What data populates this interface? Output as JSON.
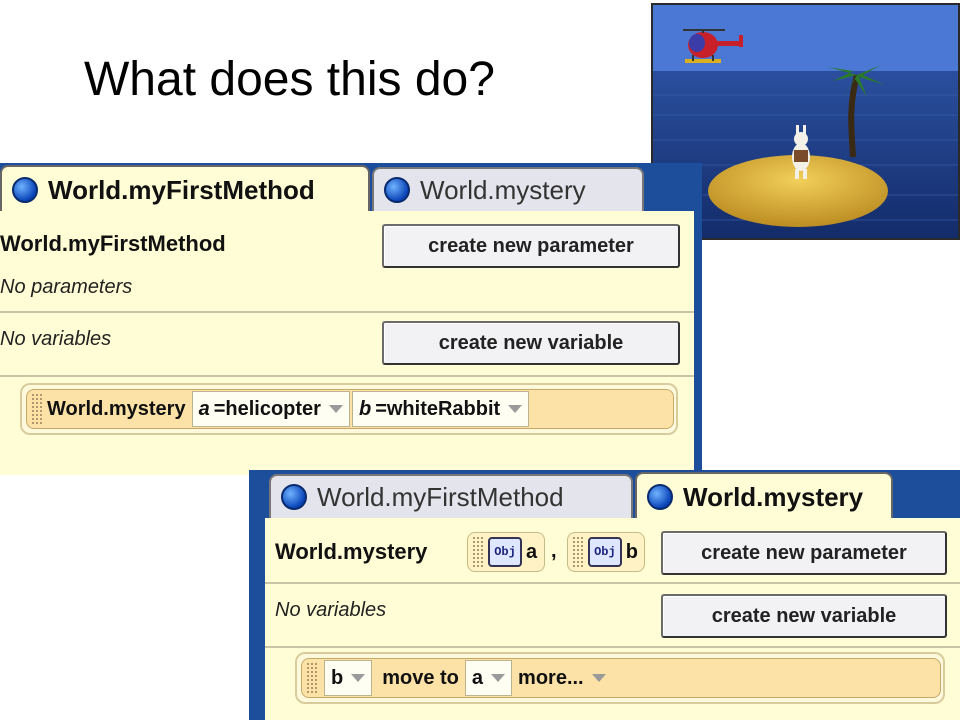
{
  "slide": {
    "title": "What does this do?"
  },
  "scene": {
    "sky_color": "#4a78d4",
    "sea_color": "#1b3b86",
    "sand_color": "#e0b640"
  },
  "panel1": {
    "tabs": [
      {
        "label": "World.myFirstMethod",
        "active": true
      },
      {
        "label": "World.mystery",
        "active": false
      }
    ],
    "method_name": "World.myFirstMethod",
    "parameters_note": "No parameters",
    "variables_note": "No variables",
    "create_parameter_button": "create new parameter",
    "create_variable_button": "create new variable",
    "statement": {
      "call": "World.mystery",
      "arg_a_name": "a",
      "arg_a_eq": "=",
      "arg_a_value": "helicopter",
      "arg_b_name": "b",
      "arg_b_eq": "=",
      "arg_b_value": "whiteRabbit"
    }
  },
  "panel2": {
    "tabs": [
      {
        "label": "World.myFirstMethod",
        "active": false
      },
      {
        "label": "World.mystery",
        "active": true
      }
    ],
    "method_name": "World.mystery",
    "params": [
      {
        "icon": "Obj",
        "name": "a"
      },
      {
        "icon": "Obj",
        "name": "b"
      }
    ],
    "param_separator": ",",
    "variables_note": "No variables",
    "create_parameter_button": "create new parameter",
    "create_variable_button": "create new variable",
    "statement": {
      "target": "b",
      "verb": "move to",
      "destination": "a",
      "more": "more..."
    }
  }
}
